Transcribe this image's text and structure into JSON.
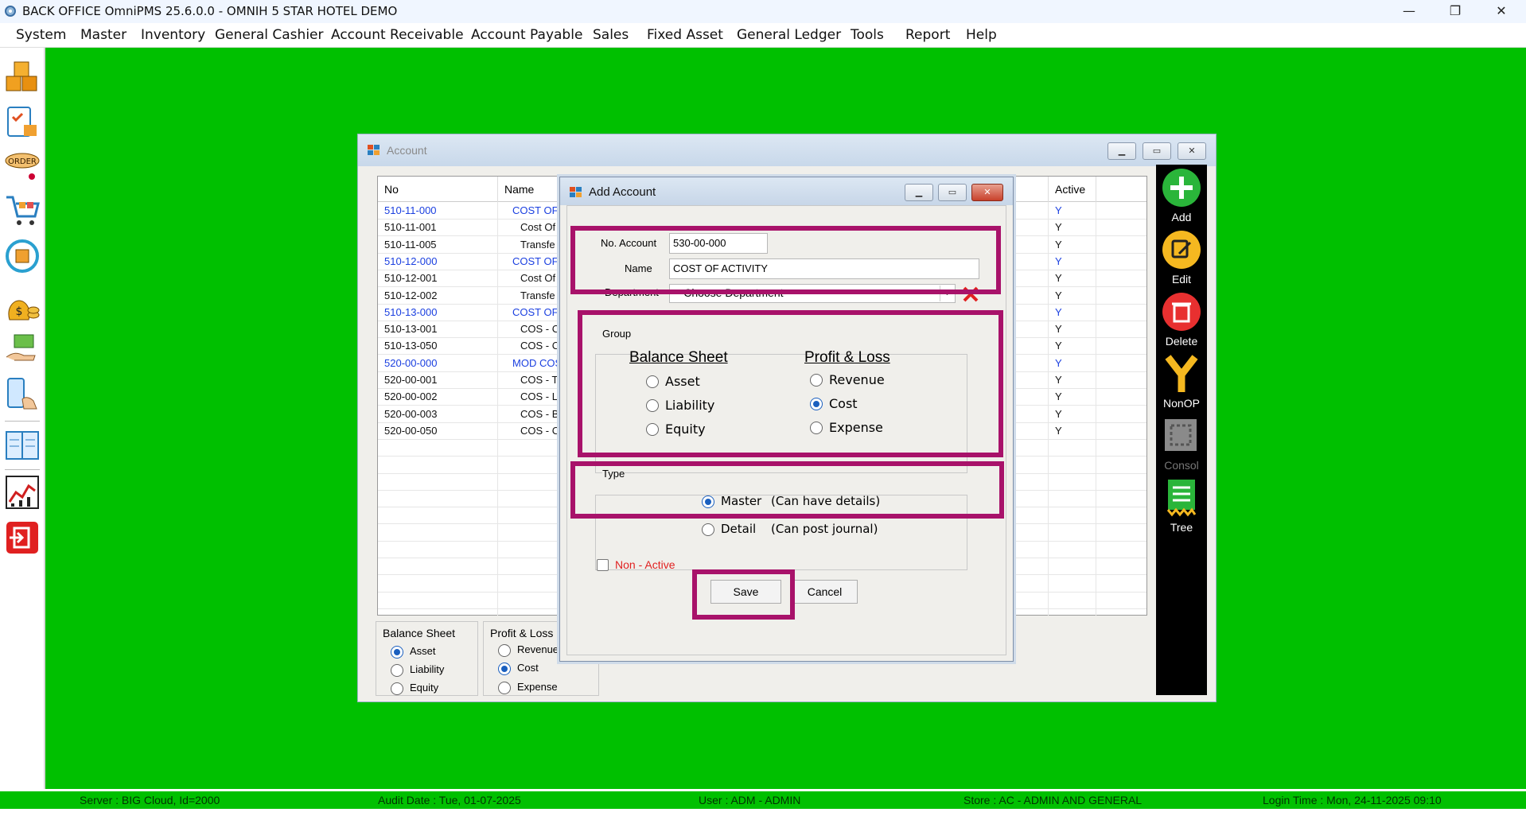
{
  "app": {
    "title": "BACK OFFICE OmniPMS 25.6.0.0 - OMNIH 5 STAR HOTEL DEMO"
  },
  "menu": [
    "System",
    "Master",
    "Inventory",
    "General Cashier",
    "Account Receivable",
    "Account Payable",
    "Sales",
    "Fixed Asset",
    "General Ledger",
    "Tools",
    "Report",
    "Help"
  ],
  "left_toolbar": [
    "boxes-icon",
    "clipboard-bag-icon",
    "order-icon",
    "cart-icon",
    "refresh-box-icon",
    "money-bags-icon",
    "hand-money-icon",
    "mobile-touch-icon",
    "ledger-book-icon",
    "chart-report-icon",
    "exit-icon"
  ],
  "account_window": {
    "title": "Account",
    "columns": {
      "no": "No",
      "name": "Name",
      "active": "Active"
    },
    "rows": [
      {
        "no": "510-11-000",
        "name": "COST OF",
        "active": "Y",
        "master": true
      },
      {
        "no": "510-11-001",
        "name": "Cost Of",
        "active": "Y",
        "master": false
      },
      {
        "no": "510-11-005",
        "name": "Transfe",
        "active": "Y",
        "master": false
      },
      {
        "no": "510-12-000",
        "name": "COST OF",
        "active": "Y",
        "master": true
      },
      {
        "no": "510-12-001",
        "name": "Cost Of",
        "active": "Y",
        "master": false
      },
      {
        "no": "510-12-002",
        "name": "Transfe",
        "active": "Y",
        "master": false
      },
      {
        "no": "510-13-000",
        "name": "COST OF",
        "active": "Y",
        "master": true
      },
      {
        "no": "510-13-001",
        "name": "COS - C",
        "active": "Y",
        "master": false
      },
      {
        "no": "510-13-050",
        "name": "COS - C",
        "active": "Y",
        "master": false
      },
      {
        "no": "520-00-000",
        "name": "MOD COS",
        "active": "Y",
        "master": true
      },
      {
        "no": "520-00-001",
        "name": "COS - T",
        "active": "Y",
        "master": false
      },
      {
        "no": "520-00-002",
        "name": "COS - L",
        "active": "Y",
        "master": false
      },
      {
        "no": "520-00-003",
        "name": "COS - B",
        "active": "Y",
        "master": false
      },
      {
        "no": "520-00-050",
        "name": "COS - C",
        "active": "Y",
        "master": false
      }
    ],
    "toolbar": {
      "add": "Add",
      "edit": "Edit",
      "delete": "Delete",
      "nonop": "NonOP",
      "consol": "Consol",
      "tree": "Tree"
    },
    "filter_balance": {
      "title": "Balance Sheet",
      "asset": "Asset",
      "liability": "Liability",
      "equity": "Equity",
      "selected": "Asset"
    },
    "filter_pl": {
      "title": "Profit & Loss",
      "revenue": "Revenue",
      "cost": "Cost",
      "expense": "Expense",
      "selected": "Cost"
    }
  },
  "dialog": {
    "title": "Add Account",
    "no_label": "No. Account",
    "no_value": "530-00-000",
    "name_label": "Name",
    "name_value": "COST OF ACTIVITY",
    "dept_label": "Department",
    "dept_value": "-- Choose Department --",
    "group_label": "Group",
    "balance_title": "Balance Sheet",
    "asset": "Asset",
    "liability": "Liability",
    "equity": "Equity",
    "pl_title": "Profit & Loss",
    "revenue": "Revenue",
    "cost": "Cost",
    "expense": "Expense",
    "group_selected": "Cost",
    "type_label": "Type",
    "master": "Master",
    "master_note": "(Can have details)",
    "detail": "Detail",
    "detail_note": "(Can post journal)",
    "type_selected": "Master",
    "nonactive": "Non - Active",
    "nonactive_checked": false,
    "save": "Save",
    "cancel": "Cancel"
  },
  "status": {
    "server": "Server : BIG Cloud, Id=2000",
    "audit": "Audit Date : Tue, 01-07-2025",
    "user": "User : ADM - ADMIN",
    "store": "Store : AC - ADMIN AND GENERAL",
    "login": "Login Time : Mon, 24-11-2025 09:10"
  },
  "colors": {
    "desktop": "#00c000",
    "highlight": "#a8126a",
    "link": "#1a3fe0",
    "accent": "#1a5fbf"
  }
}
